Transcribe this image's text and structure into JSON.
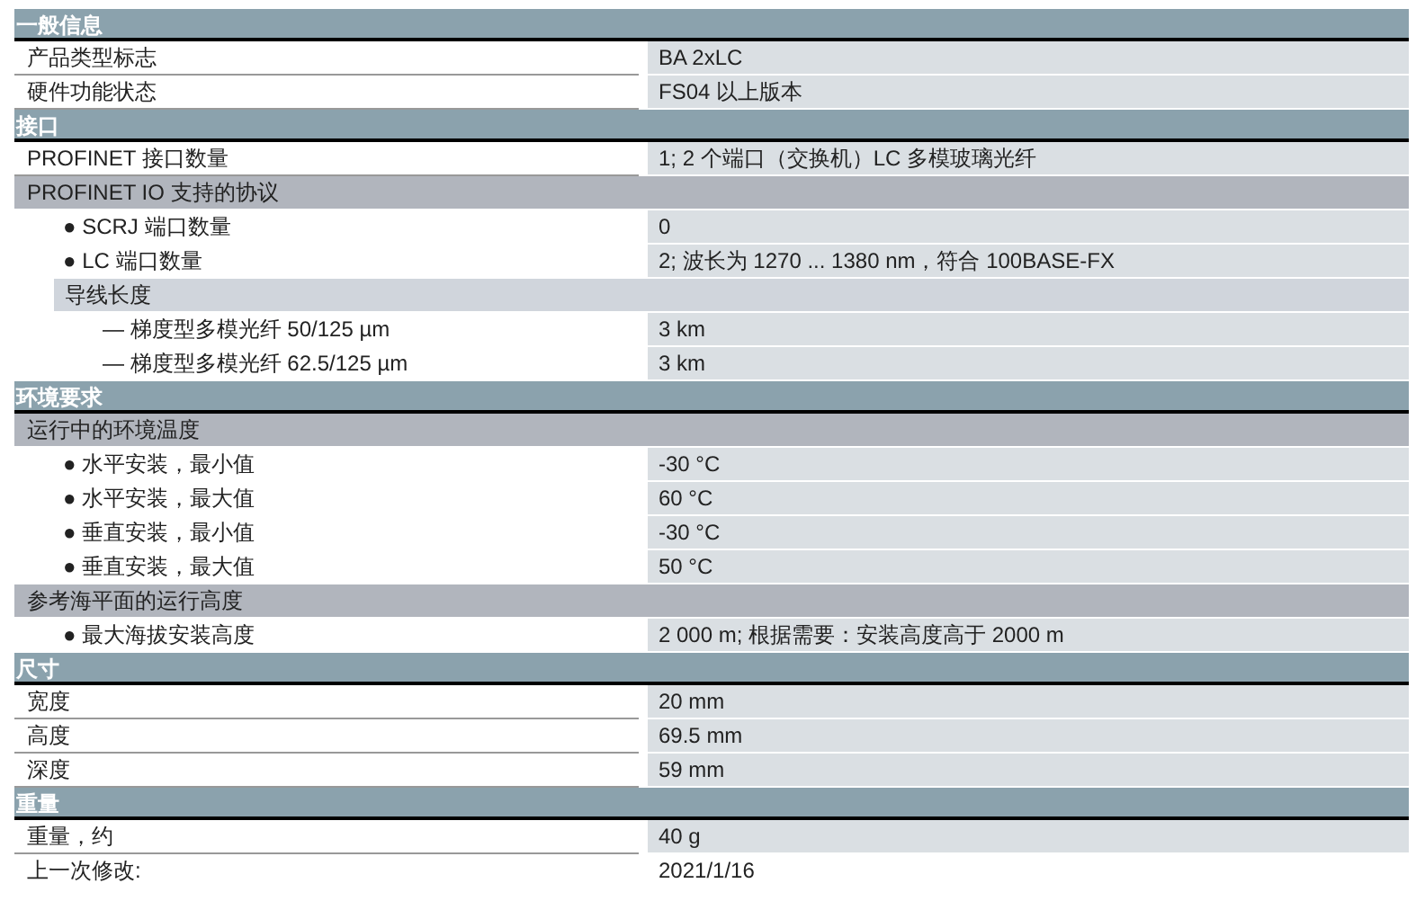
{
  "sections": [
    {
      "title": "一般信息",
      "items": [
        {
          "kind": "row",
          "label": "产品类型标志",
          "value": "BA 2xLC"
        },
        {
          "kind": "row",
          "label": "硬件功能状态",
          "value": "FS04 以上版本"
        }
      ]
    },
    {
      "title": "接口",
      "items": [
        {
          "kind": "row",
          "label": "PROFINET 接口数量",
          "value": "1; 2 个端口（交换机）LC 多模玻璃光纤"
        },
        {
          "kind": "group",
          "label": "PROFINET IO 支持的协议",
          "children": [
            {
              "kind": "row",
              "label": "● SCRJ 端口数量",
              "value": "0"
            },
            {
              "kind": "row",
              "label": "● LC 端口数量",
              "value": "2; 波长为 1270 ... 1380 nm，符合 100BASE-FX"
            },
            {
              "kind": "group",
              "label": "导线长度",
              "children": [
                {
                  "kind": "row",
                  "label": "— 梯度型多模光纤 50/125 µm",
                  "value": "3 km"
                },
                {
                  "kind": "row",
                  "label": "— 梯度型多模光纤 62.5/125 µm",
                  "value": "3 km"
                }
              ]
            }
          ]
        }
      ]
    },
    {
      "title": "环境要求",
      "items": [
        {
          "kind": "group",
          "label": "运行中的环境温度",
          "children": [
            {
              "kind": "row",
              "label": "● 水平安装，最小值",
              "value": "-30 °C"
            },
            {
              "kind": "row",
              "label": "● 水平安装，最大值",
              "value": "60 °C"
            },
            {
              "kind": "row",
              "label": "● 垂直安装，最小值",
              "value": "-30 °C"
            },
            {
              "kind": "row",
              "label": "● 垂直安装，最大值",
              "value": "50 °C"
            }
          ]
        },
        {
          "kind": "group",
          "label": "参考海平面的运行高度",
          "children": [
            {
              "kind": "row",
              "label": "● 最大海拔安装高度",
              "value": "2 000 m; 根据需要：安装高度高于 2000 m"
            }
          ]
        }
      ]
    },
    {
      "title": "尺寸",
      "items": [
        {
          "kind": "row",
          "label": "宽度",
          "value": "20 mm"
        },
        {
          "kind": "row",
          "label": "高度",
          "value": "69.5 mm"
        },
        {
          "kind": "row",
          "label": "深度",
          "value": "59 mm"
        }
      ]
    },
    {
      "title": "重量",
      "items": [
        {
          "kind": "row",
          "label": "重量，约",
          "value": "40 g"
        }
      ]
    }
  ],
  "last_modified": {
    "label": "上一次修改:",
    "value": "2021/1/16"
  }
}
